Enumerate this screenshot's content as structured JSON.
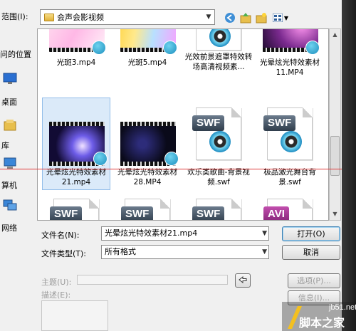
{
  "top": {
    "look_in_label": "范围(I):",
    "current_folder": "会声会影视频"
  },
  "places": {
    "recent": "问的位置",
    "desktop": "桌面",
    "libraries": "库",
    "computer": "算机",
    "network": "网络"
  },
  "files": [
    {
      "name": "光斑3.mp4",
      "kind": "video",
      "colors": [
        "#ffd1e8",
        "#ffc2f0",
        "#ffe2f2"
      ]
    },
    {
      "name": "光斑5.mp4",
      "kind": "video",
      "colors": [
        "#ffd54a",
        "#b8e0ff",
        "#f5a3ff"
      ]
    },
    {
      "name": "光效前景遮罩特效转场高清视频素...",
      "kind": "reel"
    },
    {
      "name": "光晕炫光特效素材11.MP4",
      "kind": "video",
      "colors": [
        "#7b2a8f",
        "#ff96f0",
        "#1a0a2a"
      ]
    },
    {
      "name": "光晕炫光特效素材21.mp4",
      "kind": "video",
      "colors": [
        "#120b34",
        "#6d5ce8",
        "#e7d8ff"
      ],
      "selected": true
    },
    {
      "name": "光晕炫光特效素材28.MP4",
      "kind": "video",
      "colors": [
        "#050510",
        "#2d2c7a",
        "#0a0a1a"
      ]
    },
    {
      "name": "欢乐类歌曲-背景视频.swf",
      "kind": "swf",
      "tag": "SWF"
    },
    {
      "name": "极品激光舞台背景.swf",
      "kind": "swf",
      "tag": "SWF"
    },
    {
      "name": "",
      "kind": "partial",
      "tag": "SWF"
    },
    {
      "name": "",
      "kind": "partial",
      "tag": "SWF"
    },
    {
      "name": "",
      "kind": "partial",
      "tag": "SWF"
    },
    {
      "name": "",
      "kind": "partial",
      "tag": "AVI"
    }
  ],
  "form": {
    "filename_label": "文件名(N):",
    "filename_value": "光晕炫光特效素材21.mp4",
    "filetype_label": "文件类型(T):",
    "filetype_value": "所有格式",
    "open_button": "打开(O)",
    "cancel_button": "取消",
    "subject_label": "主题(U):",
    "description_label": "描述(E):",
    "options_button": "选项(P)...",
    "info_button": "信息(I)..."
  },
  "watermark": {
    "url": "jb51.net",
    "text": "脚本之家"
  }
}
